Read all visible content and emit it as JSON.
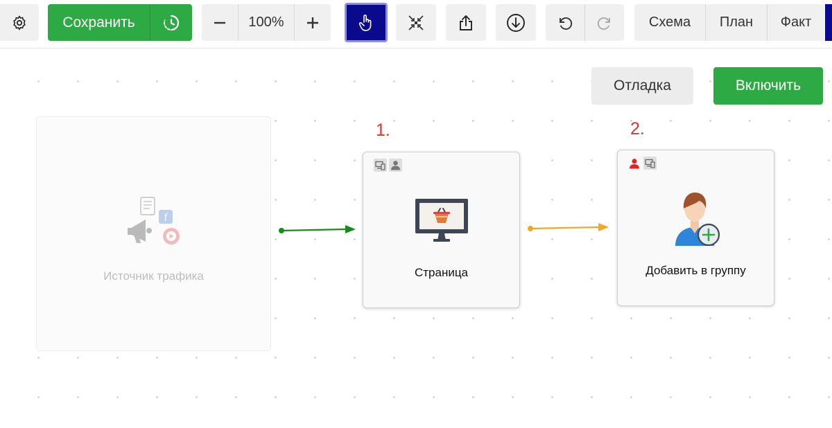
{
  "toolbar": {
    "save_label": "Сохранить",
    "zoom_value": "100%",
    "tabs": [
      {
        "label": "Схема"
      },
      {
        "label": "План"
      },
      {
        "label": "Факт"
      }
    ]
  },
  "actions": {
    "debug_label": "Отладка",
    "enable_label": "Включить"
  },
  "nodes": {
    "traffic_source": {
      "label": "Источник трафика",
      "icons": [
        "document-icon",
        "facebook-icon",
        "megaphone-icon",
        "play-icon"
      ]
    },
    "page": {
      "number": "1.",
      "label": "Страница",
      "icons": [
        "devices-icon",
        "user-icon",
        "monitor-basket-icon"
      ]
    },
    "add_to_group": {
      "number": "2.",
      "label": "Добавить в группу",
      "icons": [
        "user-red-icon",
        "devices-icon",
        "user-add-icon"
      ]
    }
  },
  "colors": {
    "green": "#2eaa44",
    "active_tool": "#0a0a8c",
    "edge_green": "#1a8a1a",
    "edge_orange": "#f5a623",
    "step_number": "#e8322b"
  }
}
